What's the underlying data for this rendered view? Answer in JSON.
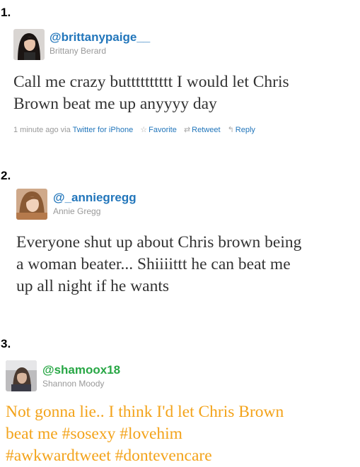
{
  "tweets": [
    {
      "number": "1.",
      "handle": "@brittanypaige__",
      "name": "Brittany Berard",
      "text": "Call me crazy butttttttttt I would let Chris Brown beat me up anyyyy day",
      "line1": "Call me crazy butttttttttt I would let Chris",
      "line2": "Brown beat me up anyyyy day",
      "time": "1 minute ago",
      "via_label": "via",
      "source": "Twitter for iPhone",
      "favorite_label": "Favorite",
      "retweet_label": "Retweet",
      "reply_label": "Reply",
      "handle_color": "#2276bb",
      "text_color": "#333333"
    },
    {
      "number": "2.",
      "handle": "@_anniegregg",
      "name": "Annie Gregg",
      "line1": "Everyone shut up about Chris brown being",
      "line2": "a woman beater... Shiiiittt he can beat me",
      "line3": "up all night if he wants",
      "handle_color": "#2276bb",
      "text_color": "#333333"
    },
    {
      "number": "3.",
      "handle": "@shamoox18",
      "name": "Shannon Moody",
      "line1": "Not gonna lie.. I think I'd let Chris Brown",
      "line2": "beat me #sosexy #lovehim",
      "line3": "#awkwardtweet #dontevencare",
      "handle_color": "#28a745",
      "text_color": "#f3a31a"
    }
  ],
  "icons": {
    "favorite": "star-outline-icon",
    "retweet": "retweet-icon",
    "reply": "reply-arrow-icon"
  }
}
